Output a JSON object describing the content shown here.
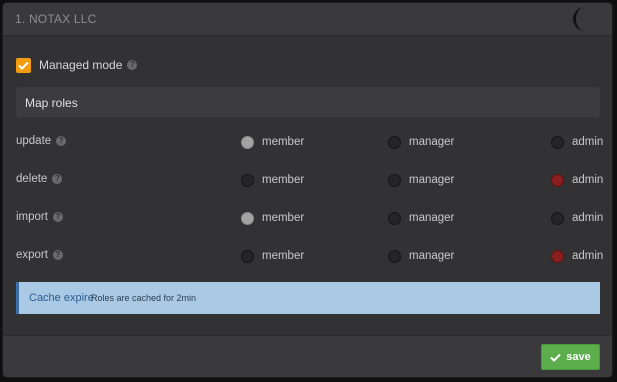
{
  "dialog": {
    "title": "1. NOTAX LLC"
  },
  "managed_mode": {
    "label": "Managed mode",
    "checked": true,
    "help_icon": "question-circle-icon"
  },
  "map_roles": {
    "heading": "Map roles"
  },
  "roles": [
    {
      "name": "update",
      "selected": "member",
      "options": [
        "member",
        "manager",
        "admin"
      ]
    },
    {
      "name": "delete",
      "selected": "admin",
      "options": [
        "member",
        "manager",
        "admin"
      ]
    },
    {
      "name": "import",
      "selected": "member",
      "options": [
        "member",
        "manager",
        "admin"
      ]
    },
    {
      "name": "export",
      "selected": "admin",
      "options": [
        "member",
        "manager",
        "admin"
      ]
    }
  ],
  "alert": {
    "strong": "Cache expire",
    "message": "Roles are cached for 2min"
  },
  "footer": {
    "save_label": "save",
    "save_icon": "check-icon"
  },
  "colors": {
    "accent_checkbox": "#f39c12",
    "selected_member": "#a3a3a3",
    "selected_admin": "#8a1f1f",
    "save_button": "#5cae4c",
    "alert_bg": "#a9c9e5"
  }
}
